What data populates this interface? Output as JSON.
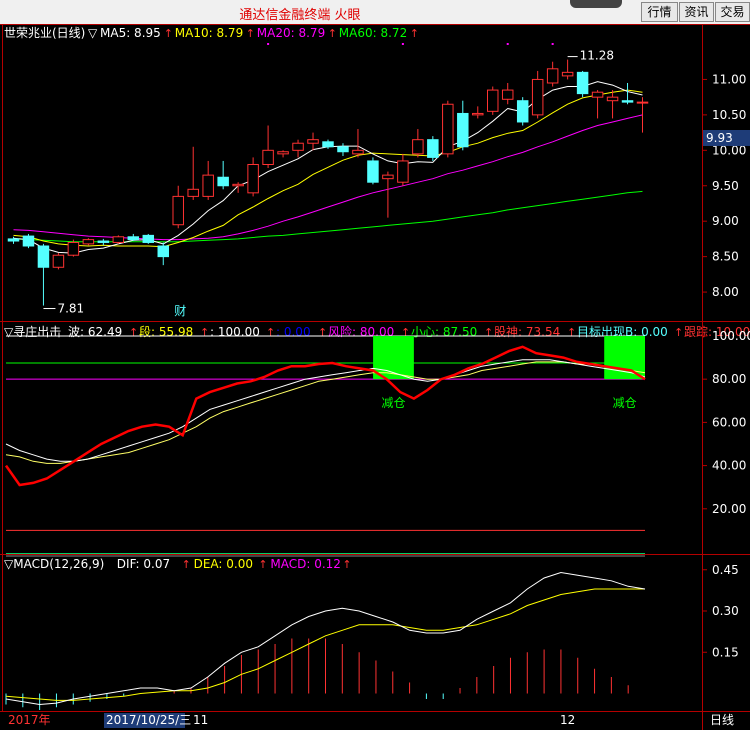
{
  "window": {
    "title": "通达信金融终端  火眼",
    "buttons": [
      "行情",
      "资讯",
      "交易"
    ]
  },
  "colors": {
    "bg": "#000000",
    "frame": "#b40000",
    "up": "#ff3232",
    "down": "#54ffff",
    "ma5": "#ffffff",
    "ma10": "#ffff00",
    "ma20": "#ff00ff",
    "ma60": "#00ff00",
    "axis_text": "#ffffff"
  },
  "main_panel": {
    "name": "世荣兆业(日线)",
    "ma_labels": [
      {
        "text": "MA5: 8.95",
        "color": "#ffffff"
      },
      {
        "text": "MA10: 8.79",
        "color": "#ffff00"
      },
      {
        "text": "MA20: 8.79",
        "color": "#ff00ff"
      },
      {
        "text": "MA60: 8.72",
        "color": "#00ff00"
      }
    ],
    "y_ticks": [
      "11.00",
      "10.50",
      "10.00",
      "9.50",
      "9.00",
      "8.50",
      "8.00"
    ],
    "current_price_tag": "9.93",
    "high_marker": "11.28",
    "low_marker": "7.81",
    "event_label": "财",
    "chart_data": {
      "type": "candlestick",
      "ohlc": [
        [
          8.75,
          8.78,
          8.68,
          8.72
        ],
        [
          8.79,
          8.82,
          8.62,
          8.65
        ],
        [
          8.65,
          8.68,
          7.81,
          8.35
        ],
        [
          8.35,
          8.55,
          8.32,
          8.52
        ],
        [
          8.52,
          8.74,
          8.5,
          8.7
        ],
        [
          8.68,
          8.76,
          8.66,
          8.74
        ],
        [
          8.72,
          8.75,
          8.66,
          8.7
        ],
        [
          8.7,
          8.8,
          8.68,
          8.78
        ],
        [
          8.78,
          8.82,
          8.72,
          8.74
        ],
        [
          8.8,
          8.82,
          8.68,
          8.7
        ],
        [
          8.65,
          8.7,
          8.38,
          8.5
        ],
        [
          8.95,
          9.5,
          8.9,
          9.35
        ],
        [
          9.35,
          10.05,
          9.3,
          9.45
        ],
        [
          9.35,
          9.85,
          9.3,
          9.65
        ],
        [
          9.62,
          9.85,
          9.45,
          9.5
        ],
        [
          9.5,
          9.55,
          9.4,
          9.52
        ],
        [
          9.4,
          9.9,
          9.35,
          9.8
        ],
        [
          9.8,
          10.35,
          9.75,
          10.0
        ],
        [
          9.95,
          10.0,
          9.9,
          9.98
        ],
        [
          10.0,
          10.15,
          9.9,
          10.1
        ],
        [
          10.1,
          10.25,
          10.0,
          10.15
        ],
        [
          10.12,
          10.15,
          10.02,
          10.05
        ],
        [
          10.05,
          10.1,
          9.92,
          9.98
        ],
        [
          9.95,
          10.3,
          9.9,
          10.0
        ],
        [
          9.85,
          9.9,
          9.52,
          9.55
        ],
        [
          9.6,
          9.7,
          9.05,
          9.65
        ],
        [
          9.55,
          9.95,
          9.5,
          9.85
        ],
        [
          9.95,
          10.3,
          9.9,
          10.15
        ],
        [
          10.15,
          10.2,
          9.85,
          9.9
        ],
        [
          9.95,
          10.7,
          9.9,
          10.65
        ],
        [
          10.52,
          10.7,
          10.0,
          10.05
        ],
        [
          10.5,
          10.62,
          10.45,
          10.52
        ],
        [
          10.55,
          10.9,
          10.5,
          10.85
        ],
        [
          10.72,
          10.95,
          10.65,
          10.85
        ],
        [
          10.7,
          10.75,
          10.35,
          10.4
        ],
        [
          10.5,
          11.12,
          10.45,
          11.0
        ],
        [
          10.95,
          11.25,
          10.9,
          11.15
        ],
        [
          11.05,
          11.28,
          11.0,
          11.1
        ],
        [
          11.1,
          11.12,
          10.75,
          10.8
        ],
        [
          10.75,
          10.85,
          10.45,
          10.82
        ],
        [
          10.7,
          10.85,
          10.45,
          10.75
        ],
        [
          10.7,
          10.95,
          10.65,
          10.68
        ],
        [
          10.68,
          10.75,
          10.25,
          10.68
        ]
      ],
      "ma5": [
        8.76,
        8.74,
        8.62,
        8.56,
        8.55,
        8.6,
        8.62,
        8.68,
        8.73,
        8.74,
        8.68,
        8.8,
        8.96,
        9.15,
        9.29,
        9.5,
        9.58,
        9.7,
        9.79,
        9.88,
        10.01,
        10.05,
        10.06,
        10.06,
        9.95,
        9.85,
        9.81,
        9.84,
        9.83,
        10.05,
        10.13,
        10.25,
        10.41,
        10.59,
        10.54,
        10.72,
        10.85,
        10.9,
        10.9,
        10.97,
        10.92,
        10.83,
        10.78
      ],
      "ma10": [
        8.8,
        8.78,
        8.72,
        8.68,
        8.66,
        8.65,
        8.66,
        8.65,
        8.65,
        8.65,
        8.64,
        8.7,
        8.77,
        8.86,
        8.94,
        9.09,
        9.2,
        9.32,
        9.43,
        9.52,
        9.66,
        9.76,
        9.86,
        9.93,
        9.96,
        9.95,
        9.94,
        9.93,
        9.92,
        9.97,
        10.05,
        10.1,
        10.18,
        10.24,
        10.28,
        10.4,
        10.53,
        10.65,
        10.74,
        10.78,
        10.82,
        10.85,
        10.82
      ],
      "ma20": [
        8.88,
        8.87,
        8.85,
        8.83,
        8.81,
        8.79,
        8.78,
        8.77,
        8.76,
        8.75,
        8.74,
        8.74,
        8.75,
        8.76,
        8.78,
        8.82,
        8.87,
        8.93,
        9.0,
        9.06,
        9.13,
        9.2,
        9.27,
        9.34,
        9.4,
        9.45,
        9.5,
        9.55,
        9.6,
        9.67,
        9.72,
        9.78,
        9.84,
        9.91,
        9.97,
        10.05,
        10.12,
        10.2,
        10.28,
        10.35,
        10.4,
        10.45,
        10.5
      ],
      "ma60": [
        8.75,
        8.74,
        8.73,
        8.72,
        8.71,
        8.71,
        8.71,
        8.71,
        8.71,
        8.71,
        8.71,
        8.71,
        8.72,
        8.73,
        8.74,
        8.75,
        8.77,
        8.79,
        8.8,
        8.82,
        8.84,
        8.86,
        8.88,
        8.9,
        8.92,
        8.94,
        8.96,
        8.98,
        9.0,
        9.03,
        9.06,
        9.09,
        9.12,
        9.16,
        9.19,
        9.22,
        9.25,
        9.28,
        9.31,
        9.34,
        9.37,
        9.4,
        9.42
      ],
      "ylim": [
        7.62,
        11.5
      ]
    }
  },
  "indicator_panel": {
    "labels": [
      {
        "text": "▽寻庄出击",
        "color": "#ffffff"
      },
      {
        "text": "波: 62.49",
        "color": "#ffffff"
      },
      {
        "text": "段: 55.98",
        "color": "#ffff00"
      },
      {
        "text": ": 100.00",
        "color": "#ffffff"
      },
      {
        "text": ": 0.00",
        "color": "#0000ff"
      },
      {
        "text": "风险: 80.00",
        "color": "#ff00ff"
      },
      {
        "text": "小心: 87.50",
        "color": "#00ff00"
      },
      {
        "text": "股神: 73.54",
        "color": "#ff3232"
      },
      {
        "text": "目标出现B: 0.00",
        "color": "#54ffff"
      },
      {
        "text": "跟踪: 10.00",
        "color": "#ff3232"
      },
      {
        "text": "目标出",
        "color": "#ff00ff"
      }
    ],
    "y_ticks": [
      "100.00",
      "80.00",
      "60.00",
      "40.00",
      "20.00"
    ],
    "signals": [
      {
        "label": "减仓",
        "from_index": 27,
        "to_index": 30
      },
      {
        "label": "减仓",
        "from_index": 44,
        "to_index": 47
      }
    ],
    "chart_data": {
      "type": "line",
      "ylim": [
        0,
        106
      ],
      "levels": {
        "top": 100,
        "caution": 87.5,
        "risk": 80,
        "track": 10
      },
      "red": [
        40,
        31,
        32,
        34,
        38,
        42,
        46,
        50,
        53,
        56,
        58,
        59,
        58,
        54,
        71,
        74,
        76,
        78,
        79,
        81,
        84,
        86,
        86,
        87,
        87.5,
        86,
        85,
        84,
        80,
        74,
        71,
        75,
        80,
        82,
        85,
        87,
        90,
        93,
        95,
        92,
        91,
        90,
        88,
        87,
        86,
        85,
        84,
        80
      ],
      "white": [
        50,
        47,
        45,
        43,
        42,
        42,
        43,
        45,
        47,
        49,
        51,
        53,
        55,
        58,
        62,
        66,
        68,
        70,
        72,
        74,
        76,
        78,
        80,
        81,
        82,
        83,
        84,
        85,
        84,
        82,
        80,
        79,
        80,
        82,
        84,
        86,
        87,
        88,
        89,
        89,
        89,
        88,
        87,
        86,
        85,
        84,
        83,
        81
      ],
      "yellow": [
        45,
        44,
        42,
        41,
        41,
        42,
        43,
        44,
        45,
        46,
        48,
        50,
        52,
        55,
        58,
        62,
        65,
        67,
        69,
        71,
        73,
        75,
        77,
        79,
        80,
        81,
        82,
        83,
        83,
        82,
        81,
        80,
        80,
        81,
        82,
        84,
        85,
        86,
        87,
        88,
        88,
        88,
        87,
        87,
        86,
        85,
        84,
        83
      ]
    }
  },
  "macd_panel": {
    "labels": [
      {
        "text": "▽MACD(12,26,9)",
        "color": "#ffffff"
      },
      {
        "text": "DIF: 0.07",
        "color": "#ffffff"
      },
      {
        "text": "DEA: 0.00",
        "color": "#ffff00"
      },
      {
        "text": "MACD: 0.12",
        "color": "#ff00ff"
      }
    ],
    "y_ticks": [
      "0.45",
      "0.30",
      "0.15"
    ],
    "chart_data": {
      "type": "line",
      "ylim": [
        -0.06,
        0.5
      ],
      "dif": [
        -0.02,
        -0.03,
        -0.04,
        -0.035,
        -0.02,
        -0.01,
        0.0,
        0.01,
        0.02,
        0.02,
        0.01,
        0.02,
        0.06,
        0.11,
        0.15,
        0.17,
        0.21,
        0.25,
        0.28,
        0.3,
        0.31,
        0.3,
        0.28,
        0.26,
        0.23,
        0.22,
        0.22,
        0.23,
        0.27,
        0.3,
        0.33,
        0.38,
        0.42,
        0.44,
        0.43,
        0.42,
        0.41,
        0.39,
        0.38
      ],
      "dea": [
        -0.01,
        -0.015,
        -0.02,
        -0.025,
        -0.025,
        -0.02,
        -0.015,
        -0.01,
        0.0,
        0.005,
        0.01,
        0.01,
        0.02,
        0.04,
        0.07,
        0.09,
        0.12,
        0.15,
        0.18,
        0.21,
        0.23,
        0.25,
        0.25,
        0.25,
        0.24,
        0.23,
        0.23,
        0.24,
        0.25,
        0.27,
        0.29,
        0.32,
        0.34,
        0.36,
        0.37,
        0.38,
        0.38,
        0.38,
        0.38
      ],
      "macd_bars": [
        -0.04,
        -0.05,
        -0.06,
        -0.05,
        -0.04,
        -0.03,
        -0.02,
        -0.01,
        0.0,
        0.0,
        0.01,
        0.02,
        0.06,
        0.1,
        0.14,
        0.16,
        0.18,
        0.2,
        0.2,
        0.2,
        0.18,
        0.15,
        0.12,
        0.08,
        0.04,
        -0.02,
        -0.02,
        0.02,
        0.06,
        0.1,
        0.13,
        0.15,
        0.16,
        0.16,
        0.13,
        0.09,
        0.06,
        0.03,
        0.0
      ]
    }
  },
  "x_axis": {
    "labels": [
      {
        "text": "2017年",
        "highlight": false
      },
      {
        "text": "2017/10/25/三",
        "highlight": true
      },
      {
        "text": "11",
        "highlight": false
      },
      {
        "text": "12",
        "highlight": false
      }
    ],
    "period_label": "日线"
  }
}
